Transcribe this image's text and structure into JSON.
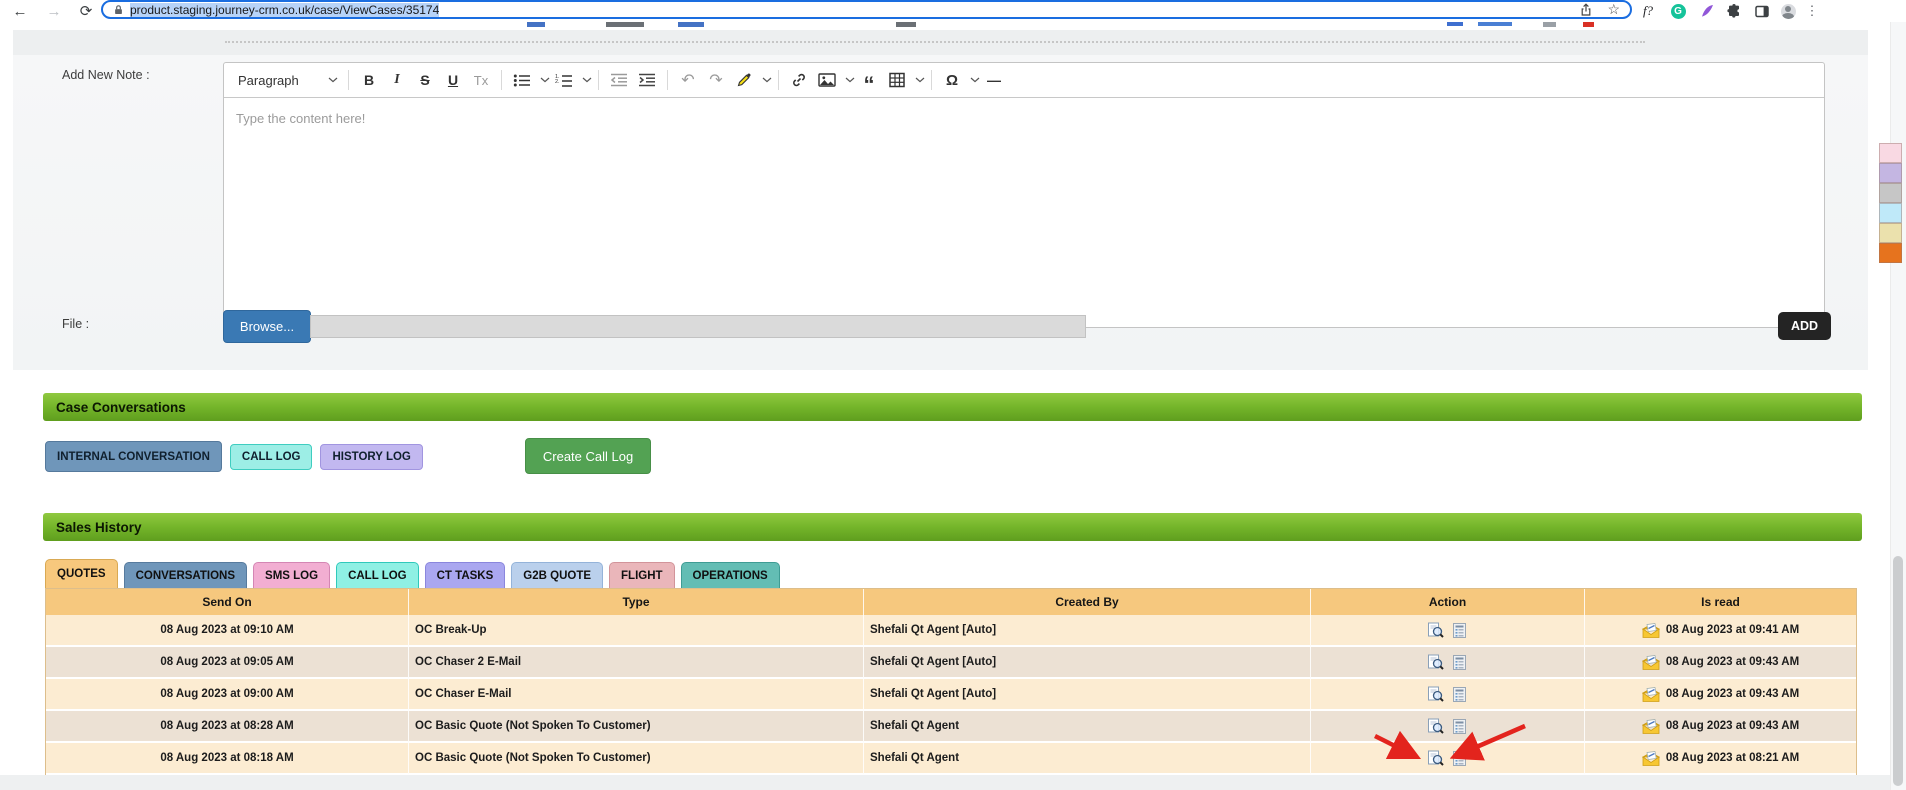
{
  "browser": {
    "url": "product.staging.journey-crm.co.uk/case/ViewCases/35174",
    "glyphs": {
      "back": "←",
      "forward": "→",
      "reload": "⟳",
      "bookmark_star": "☆",
      "fonts_badge": "f?",
      "grammarly_letter": "G",
      "menu_dots": "⋮"
    }
  },
  "note_form": {
    "note_label": "Add New Note :",
    "file_label": "File :",
    "browse_button": "Browse...",
    "add_button": "ADD",
    "editor": {
      "paragraph_dropdown": "Paragraph",
      "placeholder": "Type the content here!",
      "glyphs": {
        "bold": "B",
        "italic": "I",
        "strikethrough": "S",
        "underline": "U",
        "remove_format": "Tx",
        "undo": "↶",
        "redo": "↷",
        "block_quote": "“",
        "special_characters": "Ω",
        "horizontal_line": "—"
      }
    }
  },
  "case_conversations": {
    "title": "Case Conversations",
    "buttons": [
      {
        "label": "INTERNAL CONVERSATION",
        "color": "#6f96ba"
      },
      {
        "label": "CALL LOG",
        "color": "#9deee6"
      },
      {
        "label": "HISTORY LOG",
        "color": "#c2b8f0"
      }
    ],
    "create_button": "Create Call Log"
  },
  "sales_history": {
    "title": "Sales History",
    "tabs": [
      {
        "label": "QUOTES",
        "color": "#f7c87d",
        "active": true
      },
      {
        "label": "CONVERSATIONS",
        "color": "#6f96ba",
        "active": false
      },
      {
        "label": "SMS LOG",
        "color": "#f2aed2",
        "active": false
      },
      {
        "label": "CALL LOG",
        "color": "#8ff0e4",
        "active": false
      },
      {
        "label": "CT TASKS",
        "color": "#aaa7f0",
        "active": false
      },
      {
        "label": "G2B QUOTE",
        "color": "#bad0ec",
        "active": false
      },
      {
        "label": "FLIGHT",
        "color": "#eab6ba",
        "active": false
      },
      {
        "label": "OPERATIONS",
        "color": "#63bdb4",
        "active": false
      }
    ],
    "table": {
      "columns": [
        "Send On",
        "Type",
        "Created By",
        "Action",
        "Is read"
      ],
      "rows": [
        {
          "send_on": "08 Aug 2023 at 09:10 AM",
          "type": "OC Break-Up",
          "created_by": "Shefali Qt Agent [Auto]",
          "is_read": "08 Aug 2023 at 09:41 AM"
        },
        {
          "send_on": "08 Aug 2023 at 09:05 AM",
          "type": "OC Chaser 2 E-Mail",
          "created_by": "Shefali Qt Agent [Auto]",
          "is_read": "08 Aug 2023 at 09:43 AM"
        },
        {
          "send_on": "08 Aug 2023 at 09:00 AM",
          "type": "OC Chaser E-Mail",
          "created_by": "Shefali Qt Agent [Auto]",
          "is_read": "08 Aug 2023 at 09:43 AM"
        },
        {
          "send_on": "08 Aug 2023 at 08:28 AM",
          "type": "OC Basic Quote (Not Spoken To Customer)",
          "created_by": "Shefali Qt Agent",
          "is_read": "08 Aug 2023 at 09:43 AM"
        },
        {
          "send_on": "08 Aug 2023 at 08:18 AM",
          "type": "OC Basic Quote (Not Spoken To Customer)",
          "created_by": "Shefali Qt Agent",
          "is_read": "08 Aug 2023 at 08:21 AM"
        }
      ],
      "annotation": "Two red arrows point at the preview and details action icons of the last row"
    }
  },
  "side_palette": [
    "#f9d9e3",
    "#c4b6e2",
    "#c6c6c6",
    "#bfe9f9",
    "#ebe1ad",
    "#e6731e"
  ],
  "colors": {
    "section_header_gradient_top": "#90c940",
    "section_header_gradient_bottom": "#5f9e1e",
    "table_header": "#f6c87e",
    "row_light": "#fcecd2",
    "row_dark": "#ece1d4",
    "browse_button": "#3a79b4",
    "add_button": "#242424",
    "create_button": "#53a253",
    "arrow_red": "#e3241d",
    "envelope_yellow": "#f6c52e",
    "url_selection": "#b7d3f8",
    "url_focus_border": "#1a6de0"
  }
}
